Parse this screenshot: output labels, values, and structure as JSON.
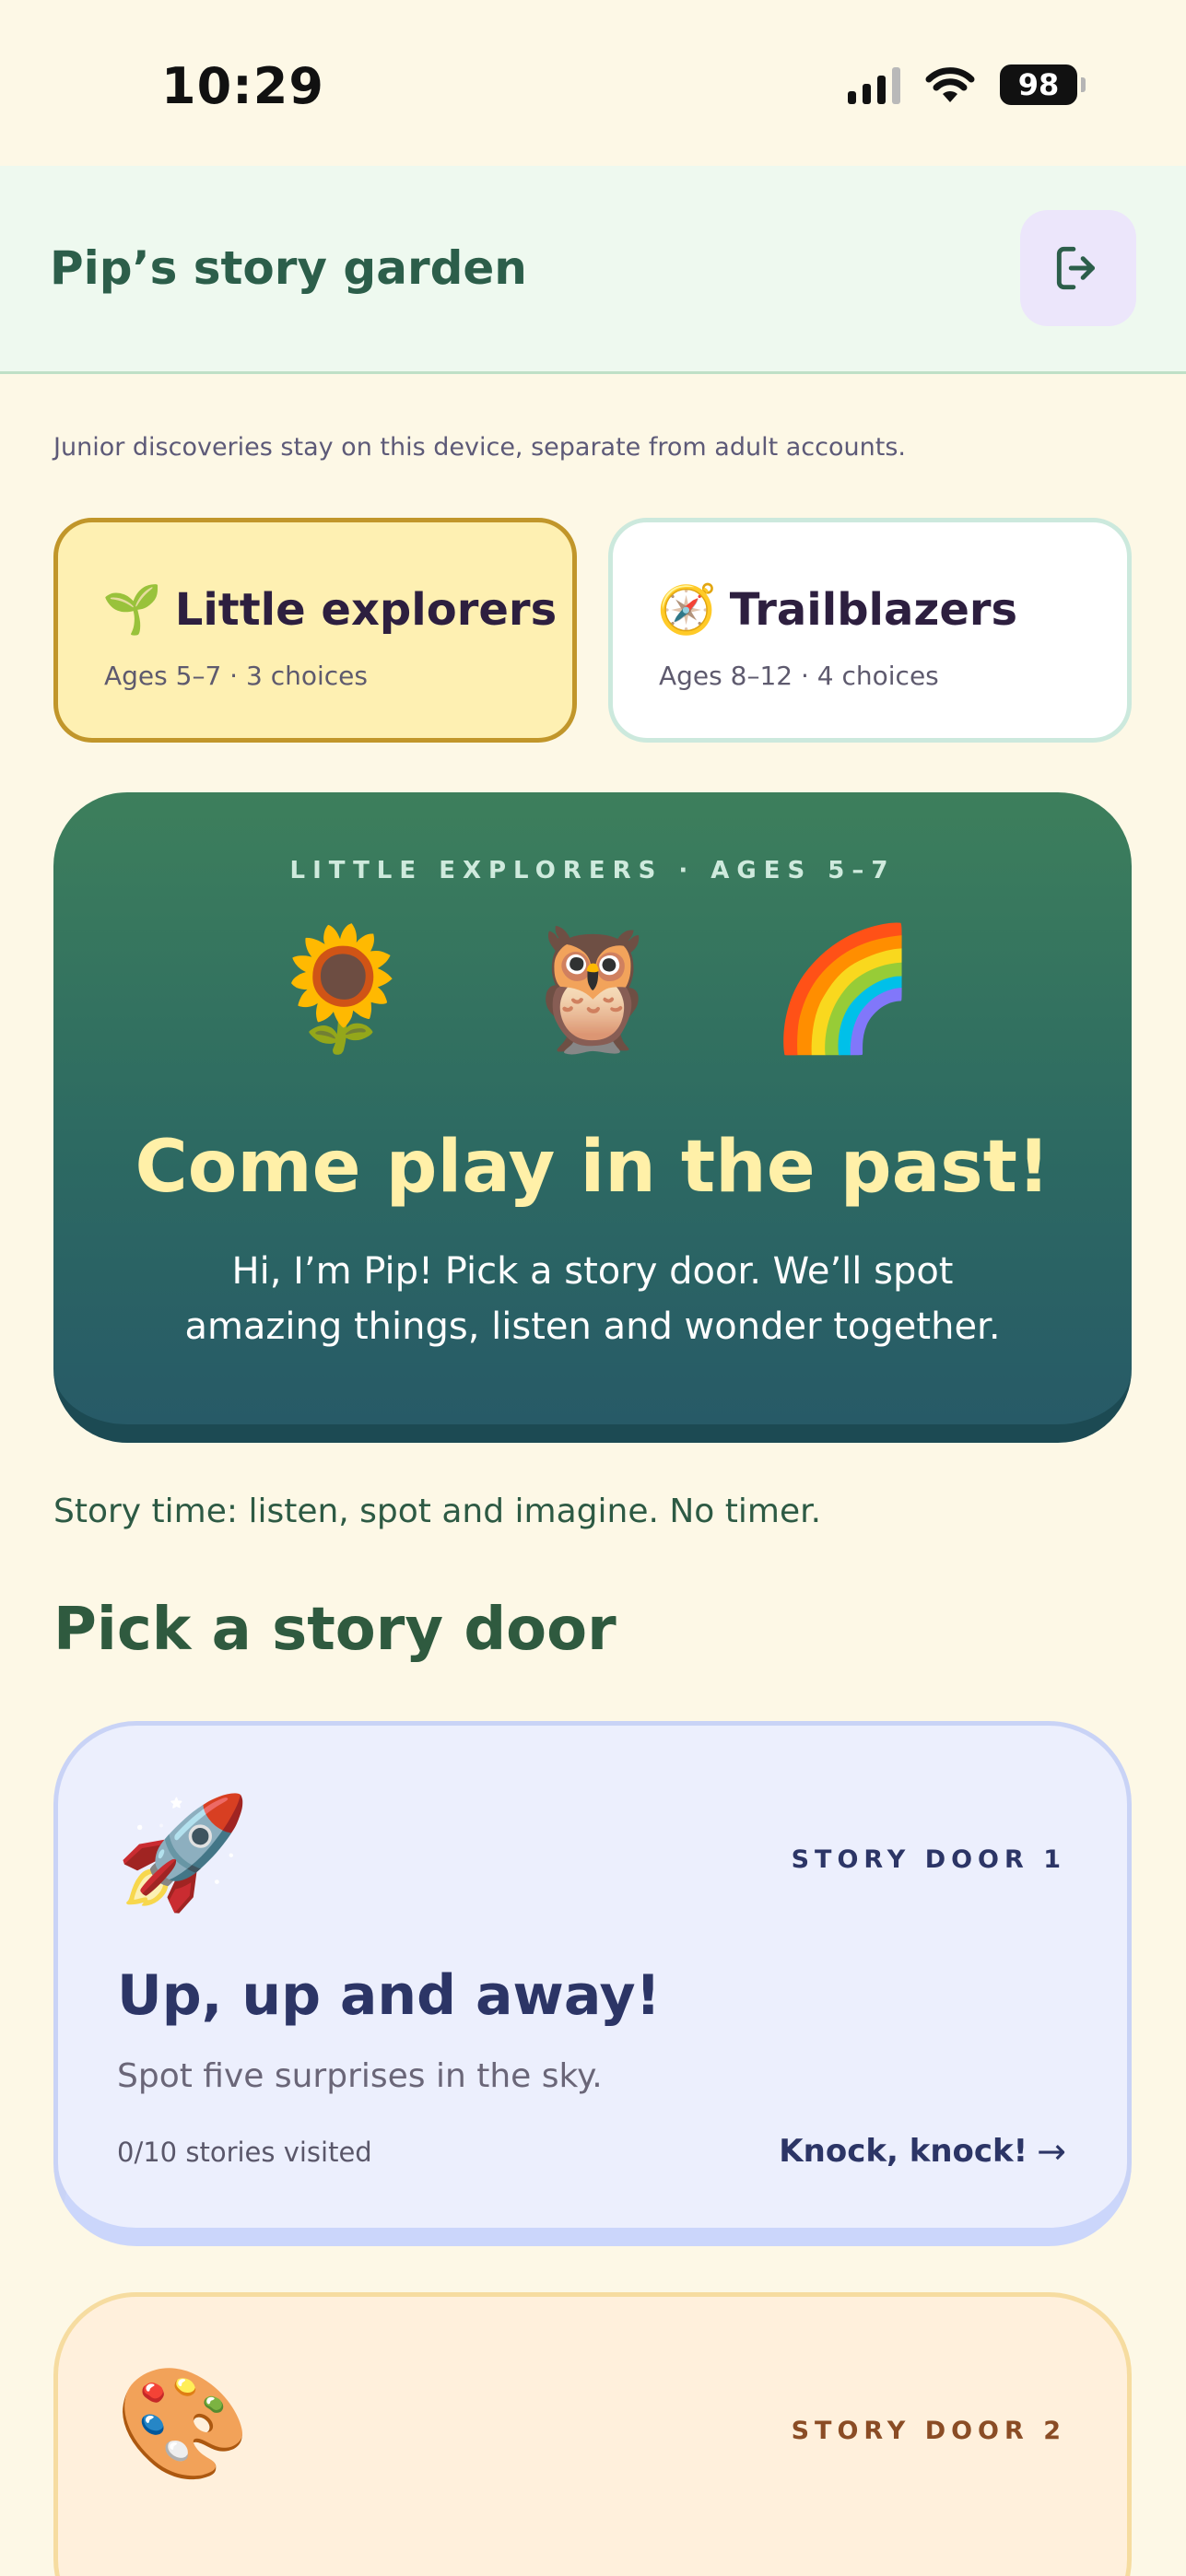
{
  "status_bar": {
    "time": "10:29",
    "battery": "98"
  },
  "header": {
    "title": "Pip’s story garden",
    "exit_icon": "logout-icon"
  },
  "privacy_note": "Junior discoveries stay on this device, separate from adult accounts.",
  "age_groups": [
    {
      "emoji": "🌱",
      "title": "Little explorers",
      "subtitle": "Ages 5–7 · 3 choices",
      "selected": true
    },
    {
      "emoji": "🧭",
      "title": "Trailblazers",
      "subtitle": "Ages 8–12 · 4 choices",
      "selected": false
    }
  ],
  "hero": {
    "eyebrow": "LITTLE EXPLORERS · AGES 5–7",
    "emojis": [
      "🌻",
      "🦉",
      "🌈"
    ],
    "title": "Come play in the past!",
    "body": "Hi, I’m Pip! Pick a story door. We’ll spot amazing things, listen and wonder together."
  },
  "timer_note": "Story time: listen, spot and imagine. No timer.",
  "section_title": "Pick a story door",
  "doors": [
    {
      "emoji": "🚀",
      "label": "STORY DOOR 1",
      "title": "Up, up and away!",
      "description": "Spot five surprises in the sky.",
      "progress": "0/10 stories visited",
      "cta": "Knock, knock!",
      "cta_arrow": "→"
    },
    {
      "emoji": "🎨",
      "label": "STORY DOOR 2"
    }
  ]
}
